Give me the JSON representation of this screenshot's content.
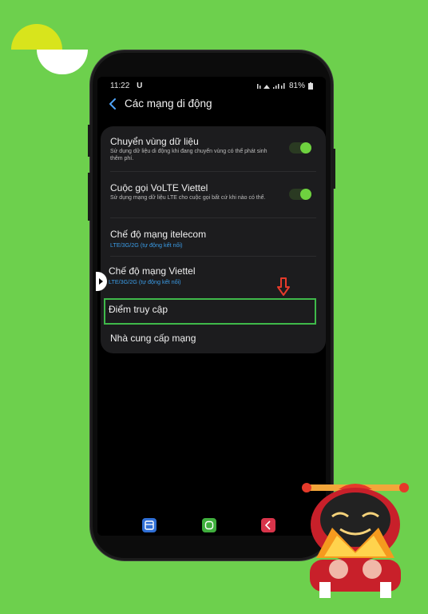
{
  "status_bar": {
    "time": "11:22",
    "carrier_icon": "U",
    "battery": "81%"
  },
  "header": {
    "title": "Các mạng di động"
  },
  "settings": [
    {
      "title": "Chuyển vùng dữ liệu",
      "desc": "Sử dụng dữ liệu di động khi đang chuyển vùng có thể phát sinh thêm phí."
    },
    {
      "title": "Cuộc gọi VoLTE Viettel",
      "desc": "Sử dụng mạng dữ liệu LTE cho cuộc gọi bất cứ khi nào có thể."
    },
    {
      "title": "Chế độ mạng itelecom",
      "sub": "LTE/3G/2G (tự động kết nối)"
    },
    {
      "title": "Chế độ mạng Viettel",
      "sub": "LTE/3G/2G (tự động kết nối)"
    },
    {
      "title": "Điểm truy cập"
    },
    {
      "title": "Nhà cung cấp mạng"
    }
  ],
  "toggles": {
    "data_roaming": true,
    "volte": true
  },
  "icons": {
    "back": "chevron-left-icon",
    "nav_recent": "recent-apps-icon",
    "nav_home": "home-icon",
    "nav_back": "back-icon",
    "annotation": "down-arrow-icon"
  },
  "colors": {
    "background": "#6dd04d",
    "toggle_on": "#6ed23f",
    "highlight_border": "#3fb94a",
    "link_blue": "#3b9de8",
    "arrow_red": "#e53a2a"
  }
}
